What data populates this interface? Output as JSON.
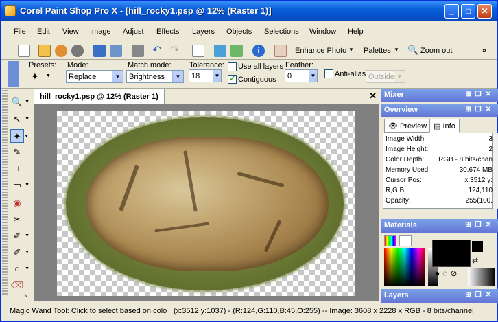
{
  "window": {
    "title": "Corel Paint Shop Pro X - [hill_rocky1.psp @  12% (Raster 1)]",
    "controls": {
      "minimize": "_",
      "maximize": "□",
      "close": "✕"
    }
  },
  "menu": [
    "File",
    "Edit",
    "View",
    "Image",
    "Adjust",
    "Effects",
    "Layers",
    "Objects",
    "Selections",
    "Window",
    "Help"
  ],
  "toolbar": {
    "enhance_photo": "Enhance Photo",
    "palettes": "Palettes",
    "zoom_out": "Zoom out",
    "more": "»"
  },
  "options": {
    "presets_label": "Presets:",
    "mode_label": "Mode:",
    "mode_value": "Replace",
    "match_mode_label": "Match mode:",
    "match_mode_value": "Brightness",
    "tolerance_label": "Tolerance:",
    "tolerance_value": "18",
    "use_all_layers": "Use all layers",
    "use_all_layers_checked": false,
    "contiguous": "Contiguous",
    "contiguous_checked": true,
    "feather_label": "Feather:",
    "feather_value": "0",
    "anti_alias": "Anti-alias",
    "anti_alias_checked": false,
    "outside_value": "Outside"
  },
  "tools": [
    {
      "icon": "zoom-icon",
      "glyph": "🔍"
    },
    {
      "icon": "pick-icon",
      "glyph": "↖"
    },
    {
      "icon": "magic-wand-icon",
      "glyph": "✦"
    },
    {
      "icon": "dropper-icon",
      "glyph": "✎"
    },
    {
      "icon": "crop-icon",
      "glyph": "⌗"
    },
    {
      "icon": "selection-icon",
      "glyph": "▭"
    },
    {
      "icon": "red-eye-icon",
      "glyph": "◉"
    },
    {
      "icon": "clone-icon",
      "glyph": "✂"
    },
    {
      "icon": "brush-icon",
      "glyph": "✐"
    },
    {
      "icon": "retouch-icon",
      "glyph": "✐"
    },
    {
      "icon": "shape-icon",
      "glyph": "○"
    },
    {
      "icon": "eraser-icon",
      "glyph": "⌫"
    }
  ],
  "document": {
    "tab_title": "hill_rocky1.psp @  12% (Raster 1)",
    "close": "✕"
  },
  "panels": {
    "mixer": "Mixer",
    "overview": "Overview",
    "preview_tab": "Preview",
    "info_tab": "Info",
    "info": [
      {
        "k": "Image Width:",
        "v": "3"
      },
      {
        "k": "Image Height:",
        "v": "2"
      },
      {
        "k": "Color Depth:",
        "v": "RGB - 8 bits/chan"
      },
      {
        "k": "Memory Used",
        "v": "30.674 MB"
      },
      {
        "k": "Cursor Pos:",
        "v": "x:3512 y:"
      },
      {
        "k": "R,G,B:",
        "v": "124,110"
      },
      {
        "k": "Opacity:",
        "v": "255(100."
      }
    ],
    "materials": "Materials",
    "layers": "Layers"
  },
  "status": {
    "tool_hint": "Magic Wand Tool: Click to select based on colo",
    "details": "(x:3512 y:1037) - (R:124,G:110,B:45,O:255) -- Image:  3608 x 2228 x RGB - 8 bits/channel"
  }
}
